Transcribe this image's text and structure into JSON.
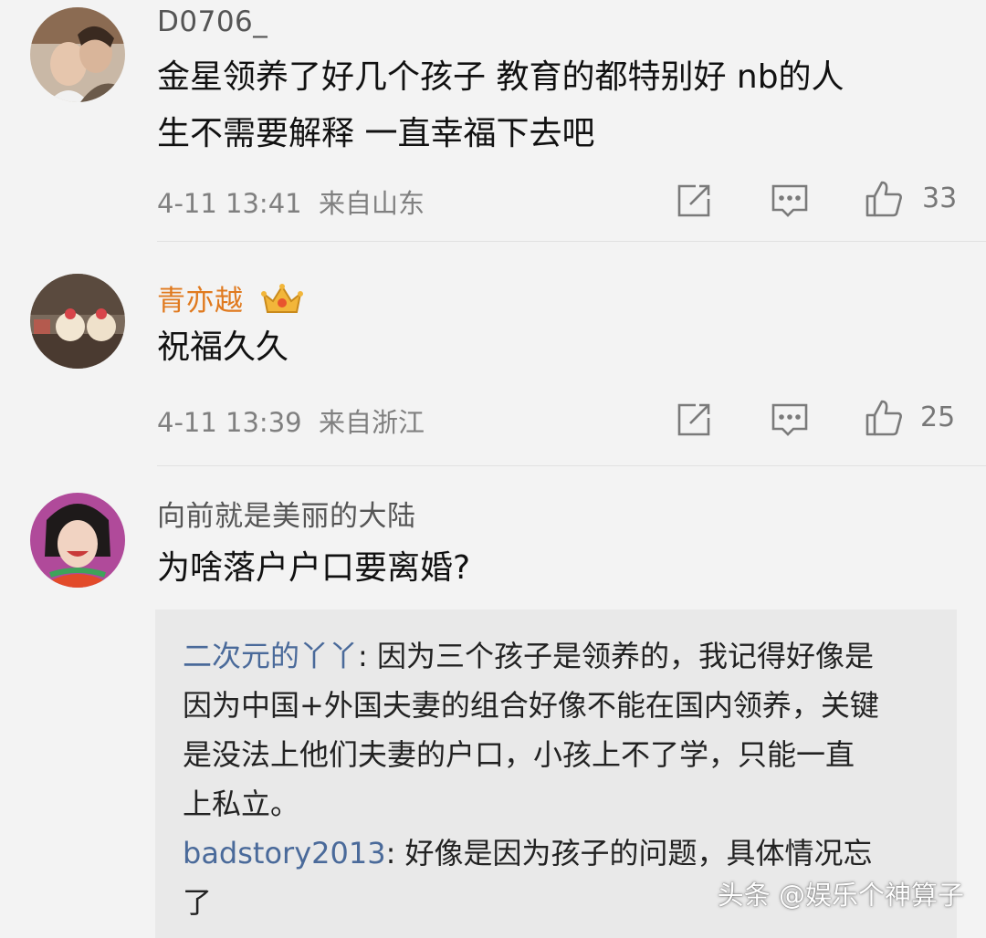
{
  "comments": [
    {
      "username": "D0706_",
      "text_line1": "金星领养了好几个孩子 教育的都特别好 nb的人",
      "text_line2": "生不需要解释 一直幸福下去吧",
      "time": "4-11 13:41",
      "location": "来自山东",
      "likes": "33"
    },
    {
      "username": "青亦越",
      "text": "祝福久久",
      "time": "4-11 13:39",
      "location": "来自浙江",
      "likes": "25"
    },
    {
      "username": "向前就是美丽的大陆",
      "text": "为啥落户户口要离婚?"
    }
  ],
  "replies": [
    {
      "name": "二次元的丫丫",
      "sep": ": ",
      "line1": "因为三个孩子是领养的，我记得好像是",
      "line2": "因为中国+外国夫妻的组合好像不能在国内领养，关键",
      "line3": "是没法上他们夫妻的户口，小孩上不了学，只能一直",
      "line4": "上私立。"
    },
    {
      "name": "badstory2013",
      "sep": ": ",
      "line1": "好像是因为孩子的问题，具体情况忘",
      "line2": "了"
    }
  ],
  "watermark": "头条 @娱乐个神算子",
  "colors": {
    "vip_name": "#e07a1f",
    "reply_name": "#4a6a9a",
    "background": "#f3f3f3"
  }
}
